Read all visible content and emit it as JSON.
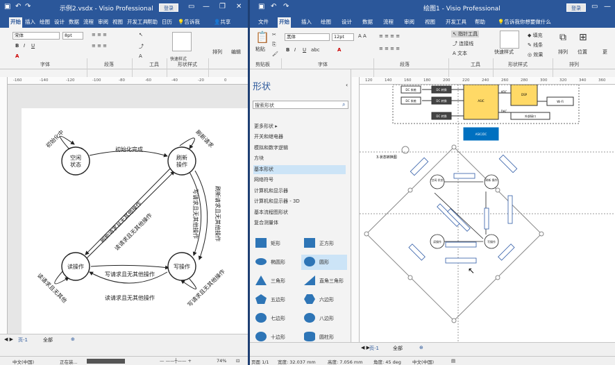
{
  "left_window": {
    "title": "示例2.vsdx - Visio Professional",
    "login_label": "登录",
    "tabs": [
      "开始",
      "插入",
      "绘图",
      "设计",
      "数据",
      "流程",
      "审阅",
      "视图",
      "开发工具",
      "帮助",
      "日历",
      "告诉我"
    ],
    "share_label": "共享",
    "font_name": "宋体",
    "font_size": "8pt",
    "groups": {
      "font": "字体",
      "paragraph": "段落",
      "tools": "工具",
      "shape_styles": "形状样式",
      "arrange": "排列",
      "edit": "编辑"
    },
    "quick_styles_label": "快速样式",
    "ruler_ticks": [
      "-160",
      "-140",
      "-120",
      "-100",
      "-80",
      "-60",
      "-40",
      "-20",
      "0"
    ],
    "page_tab": "页-1",
    "all_pages": "全部",
    "status": {
      "lang": "中文(中国)",
      "progress": "正在装...",
      "zoom": "74%"
    },
    "diagram": {
      "states": [
        "空闲\n状态",
        "刷新\n操作",
        "读操作",
        "写操作"
      ],
      "labels": {
        "init_loop": "初始化中",
        "init_done": "初始化完成",
        "refresh_req": "刷新请求",
        "refresh_other": "刷新请求且无其他操作",
        "write_other": "写请求且无其他操作",
        "refresh_other2": "刷新请求且无其他操作",
        "refresh_other3": "写请求且无其他操作",
        "read_req": "读请求且无其他操作",
        "write_req_bottom": "写请求且无其他操作",
        "read_req_bottom": "读请求且无其他操作",
        "read_loop": "读请求且无其他",
        "write_loop": "写请求且无其他操作"
      }
    }
  },
  "right_window": {
    "title": "绘图1 - Visio Professional",
    "login_label": "登录",
    "tabs": [
      "文件",
      "开始",
      "插入",
      "绘图",
      "设计",
      "数据",
      "流程",
      "审阅",
      "视图",
      "开发工具",
      "帮助",
      "告诉我你想要做什么"
    ],
    "font_name": "黑体",
    "font_size": "12pt",
    "groups": {
      "clipboard": "剪贴板",
      "font": "字体",
      "paragraph": "段落",
      "tools": "工具",
      "shape_styles": "形状样式",
      "arrange": "排列"
    },
    "paste_label": "粘贴",
    "tools": [
      "指针工具",
      "连接线",
      "文本"
    ],
    "style_items": [
      "填充",
      "线条",
      "效果"
    ],
    "arrange_items": [
      "排列",
      "位置"
    ],
    "more": "更",
    "quick_styles_label": "快速样式",
    "shapes_pane": {
      "title": "形状",
      "search_placeholder": "搜索形状",
      "more_shapes": "更多形状",
      "stencils": [
        "开关和继电器",
        "模拟和数字逻辑",
        "方块",
        "基本形状",
        "网络符号",
        "计算机和显示器",
        "计算机和显示器 - 3D",
        "基本流程图形状",
        "复合测量体"
      ],
      "selected_stencil": "基本形状",
      "masters": [
        [
          "矩形",
          "正方形"
        ],
        [
          "椭圆形",
          "圆形"
        ],
        [
          "三角形",
          "直角三角形"
        ],
        [
          "五边形",
          "六边形"
        ],
        [
          "七边形",
          "八边形"
        ],
        [
          "十边形",
          "圆柱形"
        ]
      ]
    },
    "ruler_ticks": [
      "120",
      "140",
      "160",
      "180",
      "200",
      "220",
      "240",
      "260",
      "280",
      "300",
      "320",
      "340",
      "360"
    ],
    "page_tab": "页-1",
    "all_pages": "全部",
    "status": {
      "page": "页面 1/1",
      "width": "宽度: 32.037 mm",
      "height": "高度: 7.056 mm",
      "angle": "角度: 45 deg",
      "lang": "中文(中国)"
    },
    "block_labels": [
      "DC 系统",
      "DC 系统",
      "DC 转换",
      "DC 转换",
      "DC 转换",
      "ASIC",
      "DSP",
      "Wi-Fi",
      "ADC",
      "DAC",
      "外部接口",
      "ASIC/DC",
      "3.状态转换图"
    ],
    "diagram": {
      "states": [
        "空闲\n状态",
        "刷新\n操作",
        "读操作",
        "写操作"
      ]
    }
  },
  "colors": {
    "brand": "#2b579a",
    "ribbon": "#f3f3f3",
    "selected": "#cce4f7",
    "shape_blue": "#2e75b6",
    "block_orange": "#ffd966",
    "block_blue": "#0070c0"
  }
}
